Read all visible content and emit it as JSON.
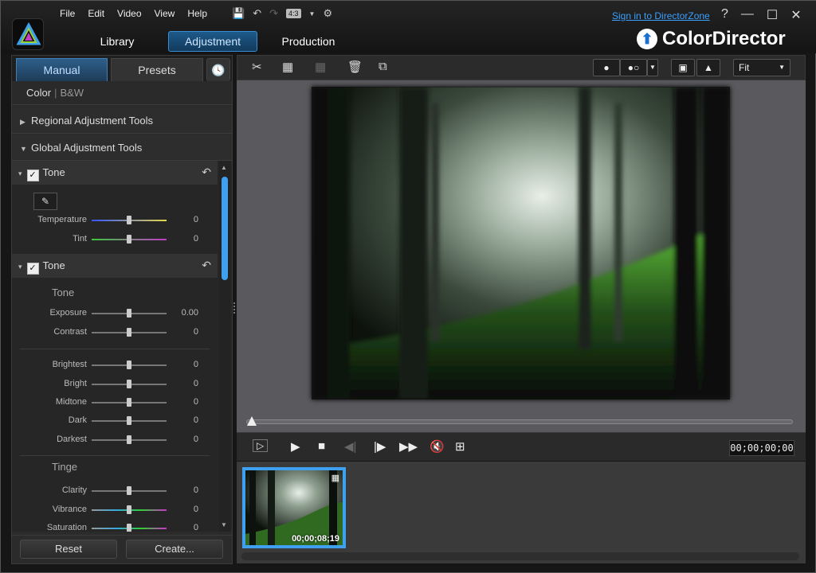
{
  "menu": [
    "File",
    "Edit",
    "Video",
    "View",
    "Help"
  ],
  "qtools": {
    "ratio": "4:3"
  },
  "signin": "Sign in to DirectorZone",
  "window_buttons": [
    "?",
    "—",
    "☐",
    "✕"
  ],
  "modes": [
    "Library",
    "Adjustment",
    "Production"
  ],
  "brand": "ColorDirector",
  "panel": {
    "tabs": [
      "Manual",
      "Presets"
    ],
    "color_label": "Color",
    "bw_label": "B&W",
    "regional": "Regional Adjustment Tools",
    "global": "Global Adjustment Tools",
    "group1": {
      "title": "Tone",
      "sliders": [
        {
          "label": "Temperature",
          "value": "0"
        },
        {
          "label": "Tint",
          "value": "0"
        }
      ]
    },
    "group2": {
      "title": "Tone",
      "sub_tone": "Tone",
      "tone_sliders": [
        {
          "label": "Exposure",
          "value": "0.00"
        },
        {
          "label": "Contrast",
          "value": "0"
        }
      ],
      "range_sliders": [
        {
          "label": "Brightest",
          "value": "0"
        },
        {
          "label": "Bright",
          "value": "0"
        },
        {
          "label": "Midtone",
          "value": "0"
        },
        {
          "label": "Dark",
          "value": "0"
        },
        {
          "label": "Darkest",
          "value": "0"
        }
      ],
      "sub_tinge": "Tinge",
      "tinge_sliders": [
        {
          "label": "Clarity",
          "value": "0"
        },
        {
          "label": "Vibrance",
          "value": "0"
        },
        {
          "label": "Saturation",
          "value": "0"
        }
      ]
    },
    "reset": "Reset",
    "create": "Create..."
  },
  "toolbar": {
    "fit": "Fit"
  },
  "timecode": "00;00;00;00",
  "clip": {
    "timecode": "00;00;08;19"
  },
  "colors": {
    "accent": "#3fa0f0",
    "brand_blue": "#1a6fd0"
  }
}
